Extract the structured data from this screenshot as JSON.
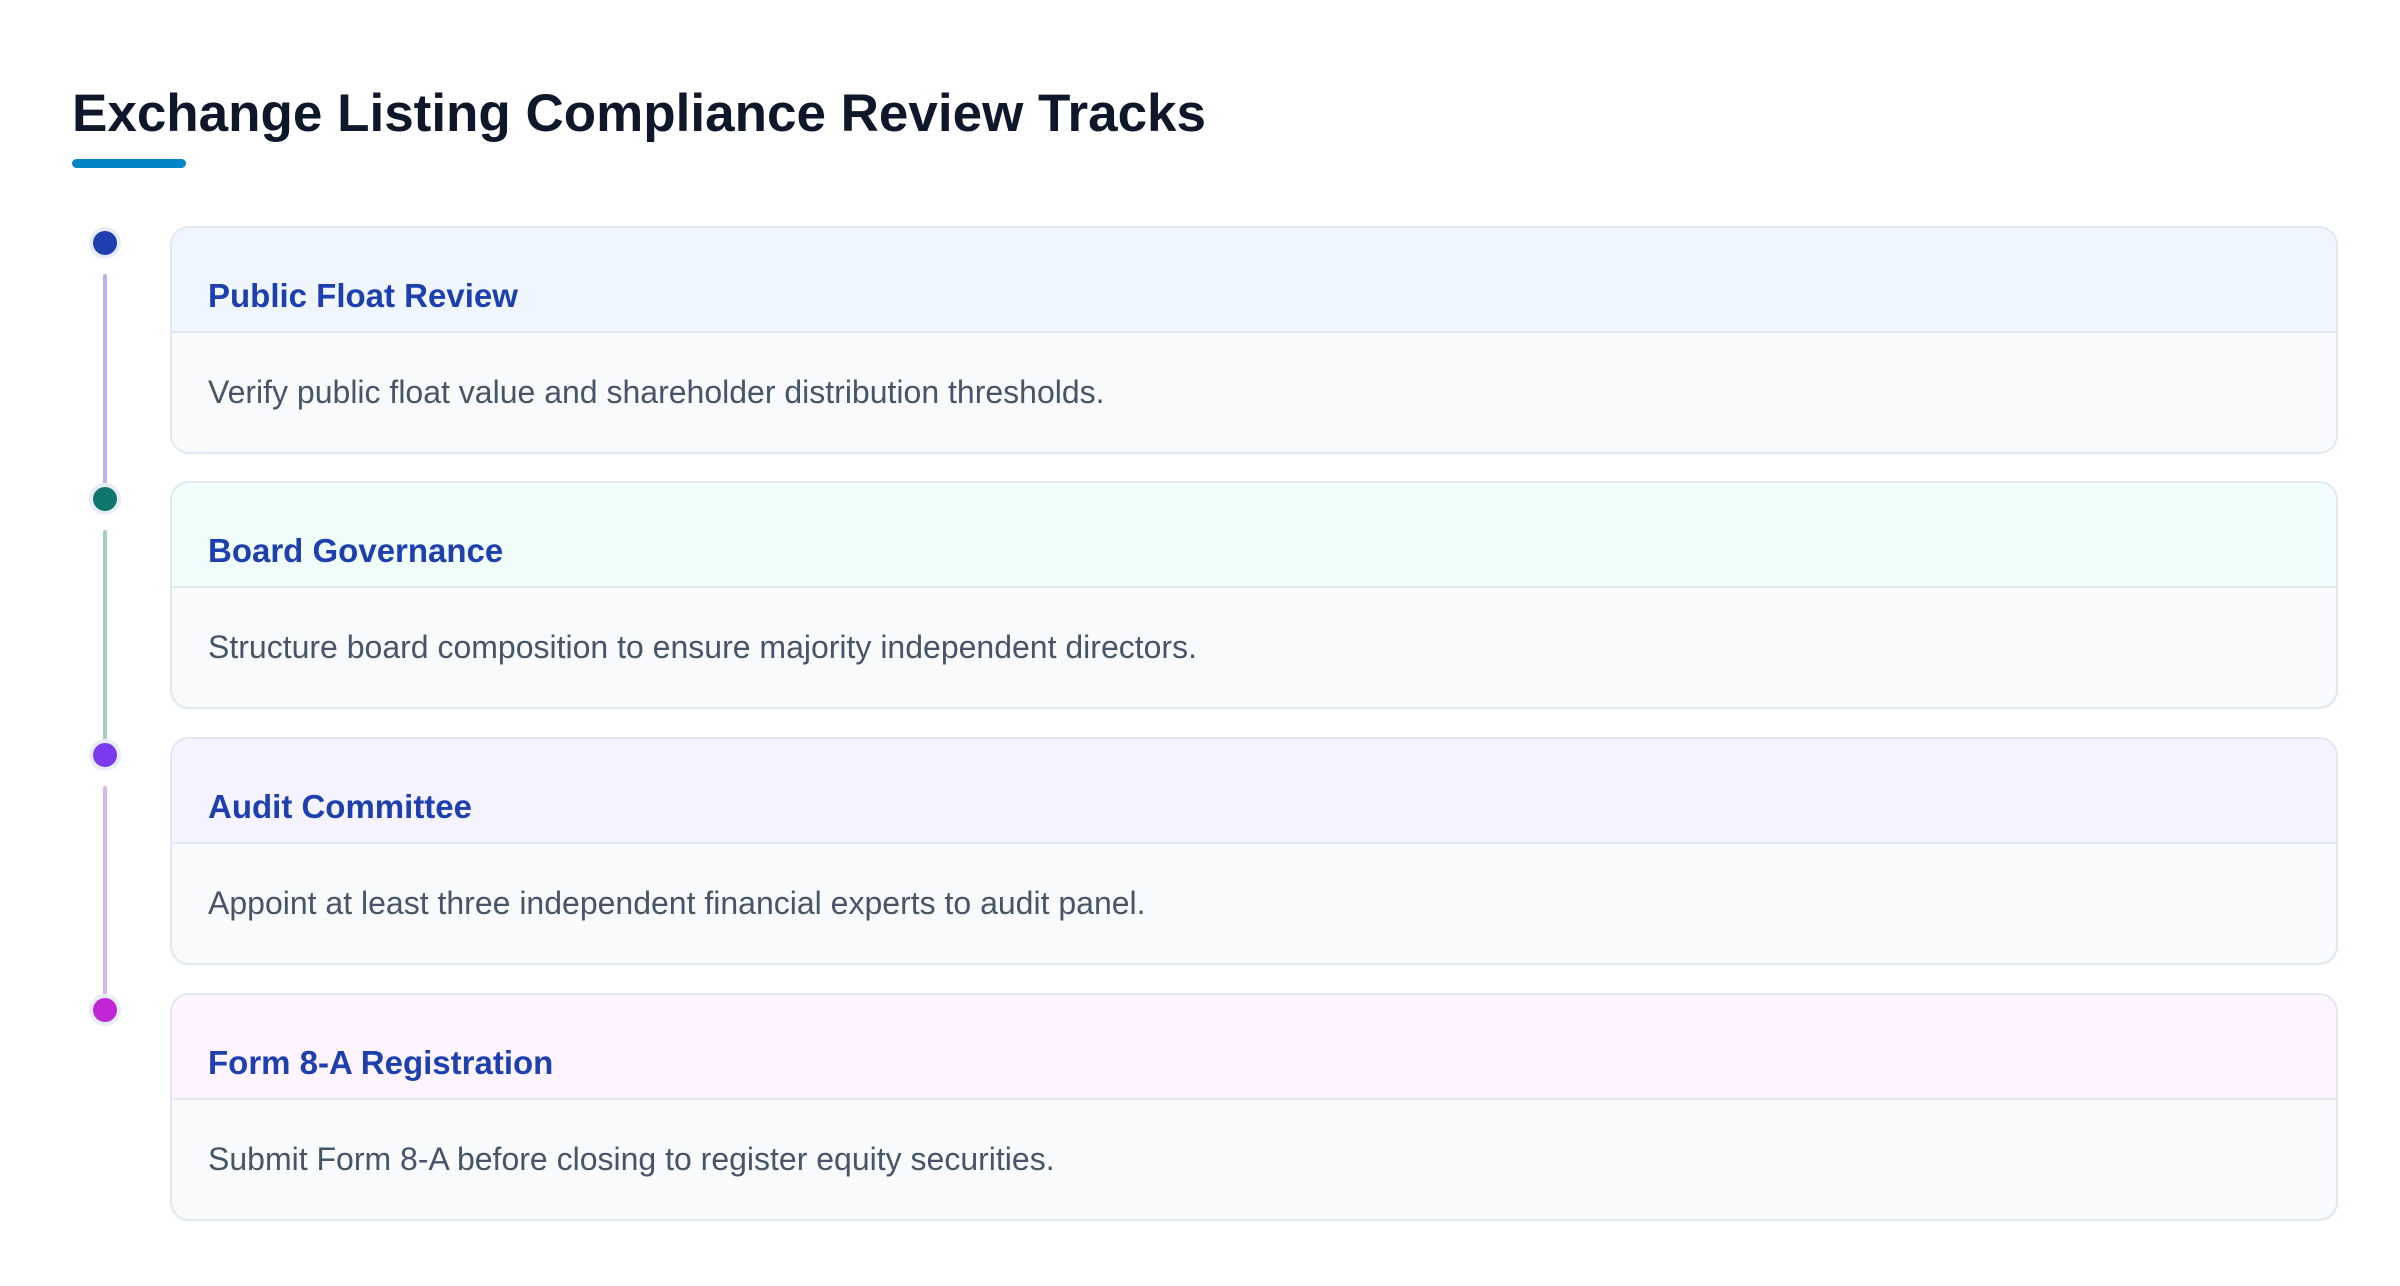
{
  "title": "Exchange Listing Compliance Review Tracks",
  "colors": {
    "title": "#0f172a",
    "underline": "#0284c7",
    "card_title": "#1e40af",
    "card_text": "#475569"
  },
  "tracks": [
    {
      "title": "Public Float Review",
      "description": "Verify public float value and shareholder distribution thresholds.",
      "dot_color": "#1e40af",
      "line_color": "#b7b5ee",
      "header_bg": "#eff6ff"
    },
    {
      "title": "Board Governance",
      "description": "Structure board composition to ensure majority independent directors.",
      "dot_color": "#0f766e",
      "line_color": "#9fcfc6",
      "header_bg": "#f0fdfa"
    },
    {
      "title": "Audit Committee",
      "description": "Appoint at least three independent financial experts to audit panel.",
      "dot_color": "#7c3aed",
      "line_color": "#d6b5f3",
      "header_bg": "#f5f3ff"
    },
    {
      "title": "Form 8-A Registration",
      "description": "Submit Form 8-A before closing to register equity securities.",
      "dot_color": "#c026d3",
      "line_color": "",
      "header_bg": "#fdf4ff"
    }
  ]
}
